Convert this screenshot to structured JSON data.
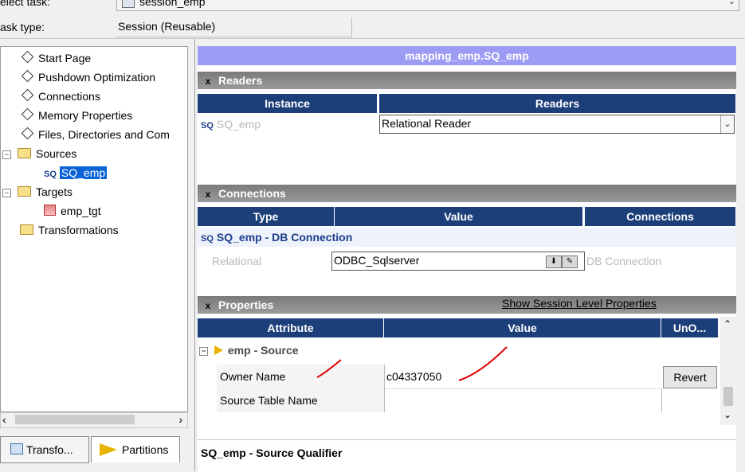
{
  "header": {
    "select_task_label": "elect task:",
    "select_task_value": "session_emp",
    "task_type_label": "ask type:",
    "task_type_value": "Session (Reusable)"
  },
  "tree": {
    "items": [
      {
        "label": "Start Page"
      },
      {
        "label": "Pushdown Optimization"
      },
      {
        "label": "Connections"
      },
      {
        "label": "Memory Properties"
      },
      {
        "label": "Files, Directories and Com"
      },
      {
        "label": "Sources"
      },
      {
        "label": "SQ_emp",
        "selected": true
      },
      {
        "label": "Targets"
      },
      {
        "label": "emp_tgt"
      },
      {
        "label": "Transformations"
      }
    ],
    "sq_badge": "SQ",
    "expander_minus": "−",
    "scroll_left": "‹",
    "scroll_right": "›"
  },
  "tabs": {
    "transformations": "Transfo...",
    "partitions": "Partitions"
  },
  "panel": {
    "title": "mapping_emp.SQ_emp",
    "readers": {
      "section": "Readers",
      "collapse_glyph": "x",
      "col_instance": "Instance",
      "col_readers": "Readers",
      "row_instance": "SQ_emp",
      "row_reader": "Relational Reader"
    },
    "connections": {
      "section": "Connections",
      "col_type": "Type",
      "col_value": "Value",
      "col_connections": "Connections",
      "group": "SQ_emp - DB Connection",
      "row_type": "Relational",
      "row_value": "ODBC_Sqlserver",
      "row_connections": "DB Connection"
    },
    "properties": {
      "section": "Properties",
      "show_session_link": "Show Session Level Properties",
      "col_attribute": "Attribute",
      "col_value": "Value",
      "col_unoverride": "UnO...",
      "group": "emp - Source",
      "rows": [
        {
          "attribute": "Owner Name",
          "value": "c04337050",
          "action": "Revert"
        },
        {
          "attribute": "Source Table Name",
          "value": "",
          "action": ""
        }
      ]
    },
    "footer": "SQ_emp - Source Qualifier"
  },
  "colors": {
    "title_bar": "#9c9cf5",
    "column_header": "#1c3f7a",
    "selection": "#0a64d6",
    "annotation": "#e00000"
  }
}
